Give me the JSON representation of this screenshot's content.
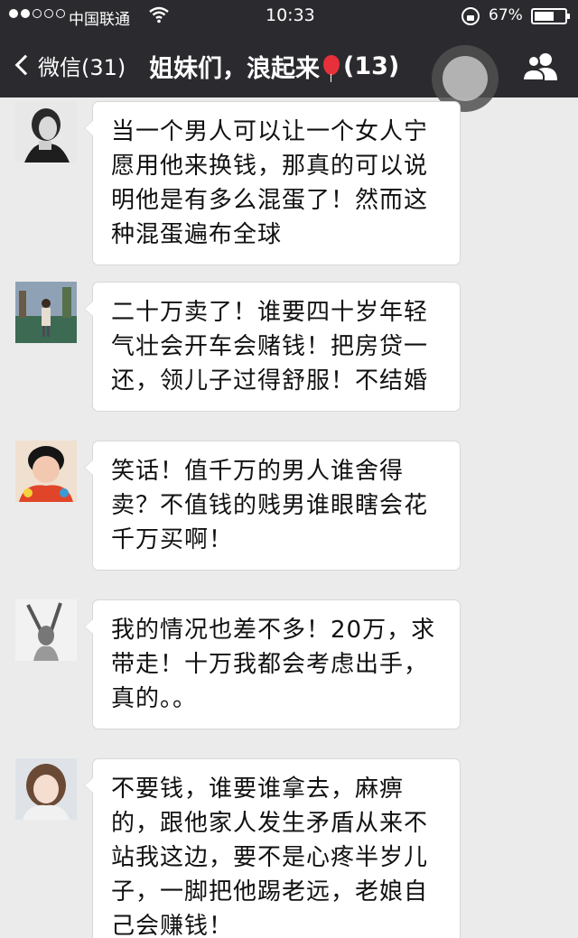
{
  "status_bar": {
    "carrier": "中国联通",
    "time": "10:33",
    "battery_pct": "67%",
    "battery_level": 0.67,
    "signal_bars": 2
  },
  "nav": {
    "back_label": "微信(31)",
    "title_before": "姐妹们，浪起来",
    "title_after": "(13)",
    "icons": [
      "chevron-left-icon",
      "balloon-icon",
      "group-members-icon"
    ]
  },
  "messages": [
    {
      "text": "当一个男人可以让一个女人宁愿用他来换钱，那真的可以说明他是有多么混蛋了！然而这种混蛋遍布全球"
    },
    {
      "text": "二十万卖了！谁要四十岁年轻气壮会开车会赌钱！把房贷一还，领儿子过得舒服！不结婚"
    },
    {
      "text": "笑话！值千万的男人谁舍得卖？不值钱的贱男谁眼瞎会花千万买啊！"
    },
    {
      "text": "我的情况也差不多！20万，求带走！十万我都会考虑出手，真的。。"
    },
    {
      "text": "不要钱，谁要谁拿去，麻痹的，跟他家人发生矛盾从来不站我这边，要不是心疼半岁儿子，一脚把他踢老远，老娘自己会赚钱！"
    }
  ],
  "colors": {
    "bar_bg": "#2b2b2f",
    "chat_bg": "#ebebeb",
    "bubble_bg": "#ffffff",
    "balloon": "#e8303a"
  }
}
